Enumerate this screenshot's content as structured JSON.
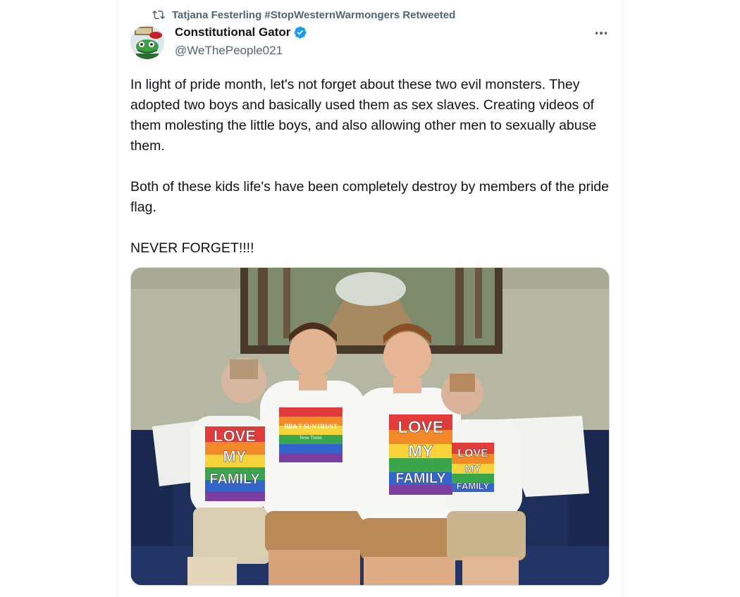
{
  "retweet": {
    "icon": "retweet-icon",
    "text": "Tatjana Festerling #StopWesternWarmongers Retweeted"
  },
  "author": {
    "name": "Constitutional Gator",
    "handle": "@WeThePeople021",
    "verified_icon": "verified-badge-icon",
    "verified_color": "#1d9bf0"
  },
  "tweet": {
    "text": "In light of pride month, let's not forget about these two evil monsters. They adopted two boys and basically used them as sex slaves. Creating videos of them molesting the little boys, and also allowing other men to sexually abuse them.\n\nBoth of these kids life's have been completely destroy by members of the pride flag.\n\nNEVER FORGET!!!!"
  },
  "media": {
    "shirt_texts": [
      "LOVE",
      "MY",
      "FAMILY"
    ],
    "shirt_logo": "BB&T SUNTRUST",
    "shirt_logo_sub": "Now Truist"
  },
  "colors": {
    "muted": "#536471",
    "text": "#0f1419",
    "couch": "#1f2f5c",
    "wall": "#b3b4a1"
  }
}
